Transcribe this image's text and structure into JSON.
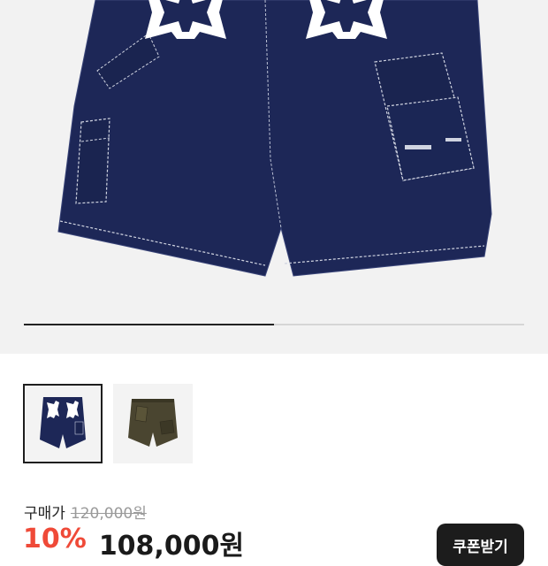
{
  "gallery": {
    "slide_progress": 0.5,
    "thumbnails": [
      {
        "name": "navy-denim-shorts",
        "selected": true
      },
      {
        "name": "olive-washed-shorts",
        "selected": false
      }
    ]
  },
  "pricing": {
    "purchase_label": "구매가",
    "original_price": "120,000원",
    "discount_rate": "10%",
    "sale_price": "108,000원",
    "coupon_button_label": "쿠폰받기"
  },
  "colors": {
    "accent_discount": "#ef4a38",
    "denim": "#1a2552",
    "button_bg": "#1c1c1c"
  }
}
